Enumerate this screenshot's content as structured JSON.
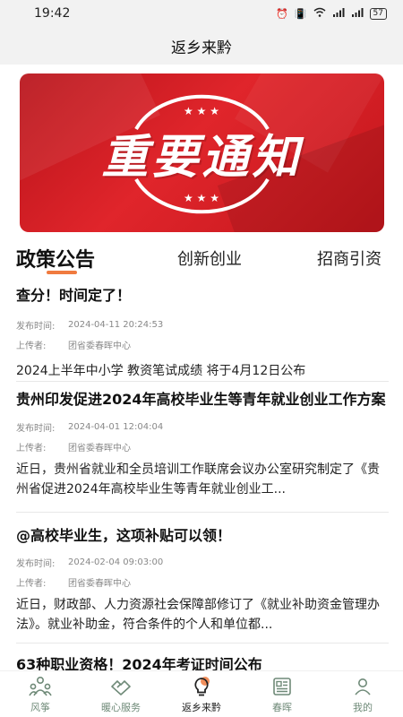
{
  "status_bar": {
    "time": "19:42",
    "icons": [
      "alarm-icon",
      "vibrate-icon",
      "wifi-icon",
      "signal-icon",
      "signal-icon"
    ],
    "network_1": "4G",
    "network_2": "4G",
    "battery": "57"
  },
  "header": {
    "title": "返乡来黔"
  },
  "banner": {
    "text": "重要通知",
    "stars": "★ ★ ★"
  },
  "tabs": [
    {
      "label": "政策公告",
      "active": true
    },
    {
      "label": "创新创业",
      "active": false
    },
    {
      "label": "招商引资",
      "active": false
    }
  ],
  "news": [
    {
      "title": "查分！时间定了！",
      "publish_label": "发布时间:",
      "publish_time": "2024-04-11 20:24:53",
      "uploader_label": "上传者:",
      "uploader": "团省委春晖中心",
      "summary": "2024上半年中小学 教资笔试成绩 将于4月12日公布"
    },
    {
      "title": "贵州印发促进2024年高校毕业生等青年就业创业工作方案",
      "publish_label": "发布时间:",
      "publish_time": "2024-04-01 12:04:04",
      "uploader_label": "上传者:",
      "uploader": "团省委春晖中心",
      "summary": "近日，贵州省就业和全员培训工作联席会议办公室研究制定了《贵州省促进2024年高校毕业生等青年就业创业工..."
    },
    {
      "title": "@高校毕业生，这项补贴可以领！",
      "publish_label": "发布时间:",
      "publish_time": "2024-02-04 09:03:00",
      "uploader_label": "上传者:",
      "uploader": "团省委春晖中心",
      "summary": "近日，财政部、人力资源社会保障部修订了《就业补助资金管理办法》。就业补助金，符合条件的个人和单位都..."
    },
    {
      "title": "63种职业资格！2024年考证时间公布"
    }
  ],
  "bottom_nav": [
    {
      "label": "风筝",
      "icon": "kite-people-icon",
      "active": false
    },
    {
      "label": "暖心服务",
      "icon": "handshake-icon",
      "active": false
    },
    {
      "label": "返乡来黔",
      "icon": "lightbulb-icon",
      "active": true
    },
    {
      "label": "春晖",
      "icon": "newspaper-icon",
      "active": false
    },
    {
      "label": "我的",
      "icon": "person-icon",
      "active": false
    }
  ],
  "colors": {
    "banner_red": "#d91f26",
    "tab_underline": "#f07b3f",
    "nav_inactive": "#6f8a78",
    "nav_active_accent": "#f07b3f"
  }
}
